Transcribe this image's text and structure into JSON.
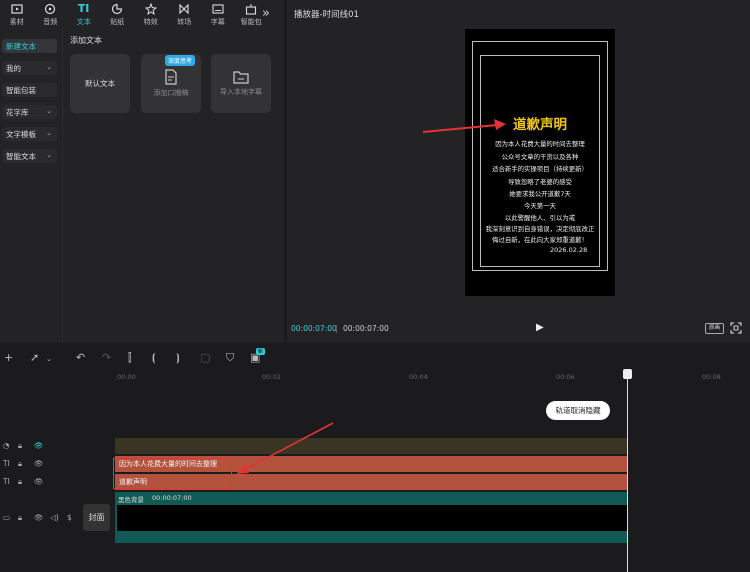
{
  "top_tabs": [
    {
      "label": "素材",
      "icon": "media-icon"
    },
    {
      "label": "音频",
      "icon": "audio-icon"
    },
    {
      "label": "文本",
      "icon": "text-icon",
      "active": true
    },
    {
      "label": "贴纸",
      "icon": "sticker-icon"
    },
    {
      "label": "特效",
      "icon": "effect-icon"
    },
    {
      "label": "转场",
      "icon": "transition-icon"
    },
    {
      "label": "字幕",
      "icon": "subtitle-icon"
    },
    {
      "label": "智能包",
      "icon": "smart-pack-icon"
    }
  ],
  "sidebar": [
    {
      "label": "新建文本",
      "active": true,
      "chevron": false
    },
    {
      "label": "我的",
      "chevron": true
    },
    {
      "label": "智能包装",
      "chevron": false
    },
    {
      "label": "花字库",
      "chevron": true
    },
    {
      "label": "文字模板",
      "chevron": true
    },
    {
      "label": "智能文本",
      "chevron": true
    }
  ],
  "section_title": "添加文本",
  "cards": [
    {
      "label": "默认文本"
    },
    {
      "label": "添加口播稿",
      "badge": "深度思考"
    },
    {
      "label": "导入本地字幕"
    }
  ],
  "player": {
    "title": "播放器-时间线01",
    "preview_title": "道歉声明",
    "lines": [
      "因为本人花费大量的时间去整理",
      "公众号文章的干货以及各种",
      "适合新手的实操项目（持续更新）",
      "导致忽略了老婆的感受",
      "她要求我公开道歉7天",
      "今天第一天",
      "以此警醒他人、引以为戒",
      "我深刻意识到自身错误，决定彻底改正",
      "悔过自新，在此向大家郑重道歉！"
    ],
    "date": "2026.02.28",
    "time_current": "00:00:07:00",
    "time_total": "00:00:07:00",
    "ratio_label": "原画"
  },
  "timeline": {
    "ticks": [
      "00:00",
      "00:02",
      "00:04",
      "00:06",
      "00:08"
    ],
    "restore_button": "轨道取消隐藏",
    "text_clip_1": "因为本人花费大量的时间去整理",
    "text_clip_2": "道歉声明",
    "video_clip_label": "黑色背景",
    "video_clip_duration": "00:00:07:00",
    "cover_label": "封面",
    "badge_new": "新"
  },
  "colors": {
    "accent": "#2fd0d8",
    "title_yellow": "#f0c419",
    "text_track": "#b3523d",
    "video_track": "#0f5a55",
    "arrow_red": "#e33333"
  }
}
